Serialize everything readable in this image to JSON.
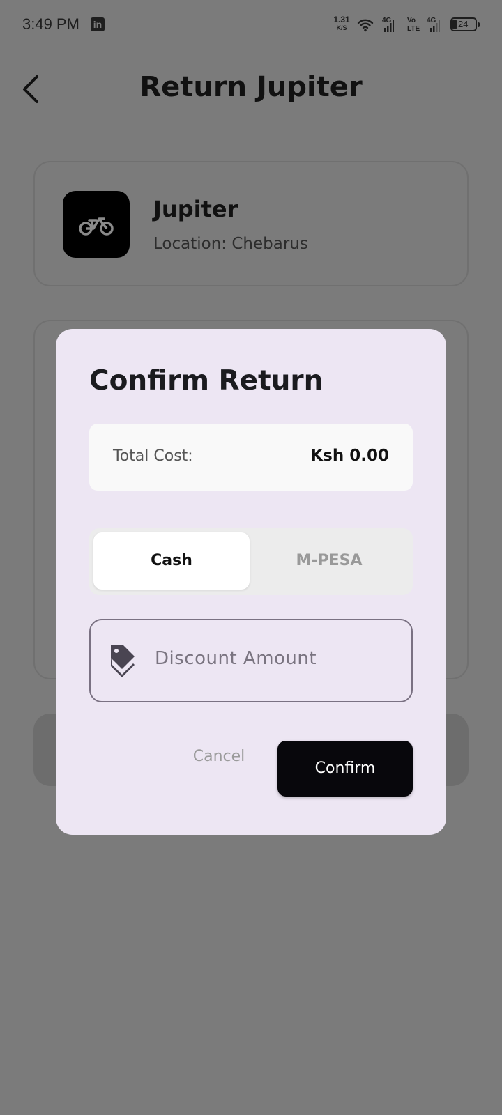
{
  "status_bar": {
    "time": "3:49 PM",
    "notification_icon": "linkedin-icon",
    "net_speed_value": "1.31",
    "net_speed_unit": "K/S",
    "signal_1_label": "4G",
    "volte_label_top": "Vo",
    "volte_label_bottom": "LTE",
    "signal_2_label": "4G",
    "battery_level": "24"
  },
  "header": {
    "back_icon": "chevron-left-icon",
    "title": "Return Jupiter"
  },
  "vehicle": {
    "icon": "scooter-icon",
    "name": "Jupiter",
    "location": "Location: Chebarus"
  },
  "dialog": {
    "title": "Confirm Return",
    "cost_label": "Total Cost:",
    "cost_value": "Ksh 0.00",
    "payment_options": [
      "Cash",
      "M-PESA"
    ],
    "selected_payment": "Cash",
    "discount_icon": "price-tag-icon",
    "discount_placeholder": "Discount Amount",
    "discount_value": "",
    "cancel_label": "Cancel",
    "confirm_label": "Confirm"
  },
  "colors": {
    "scrim": "#7b7b7b",
    "dialog_bg": "#ede6f3",
    "confirm_bg": "#08070c",
    "toggle_bg": "#ececec"
  }
}
